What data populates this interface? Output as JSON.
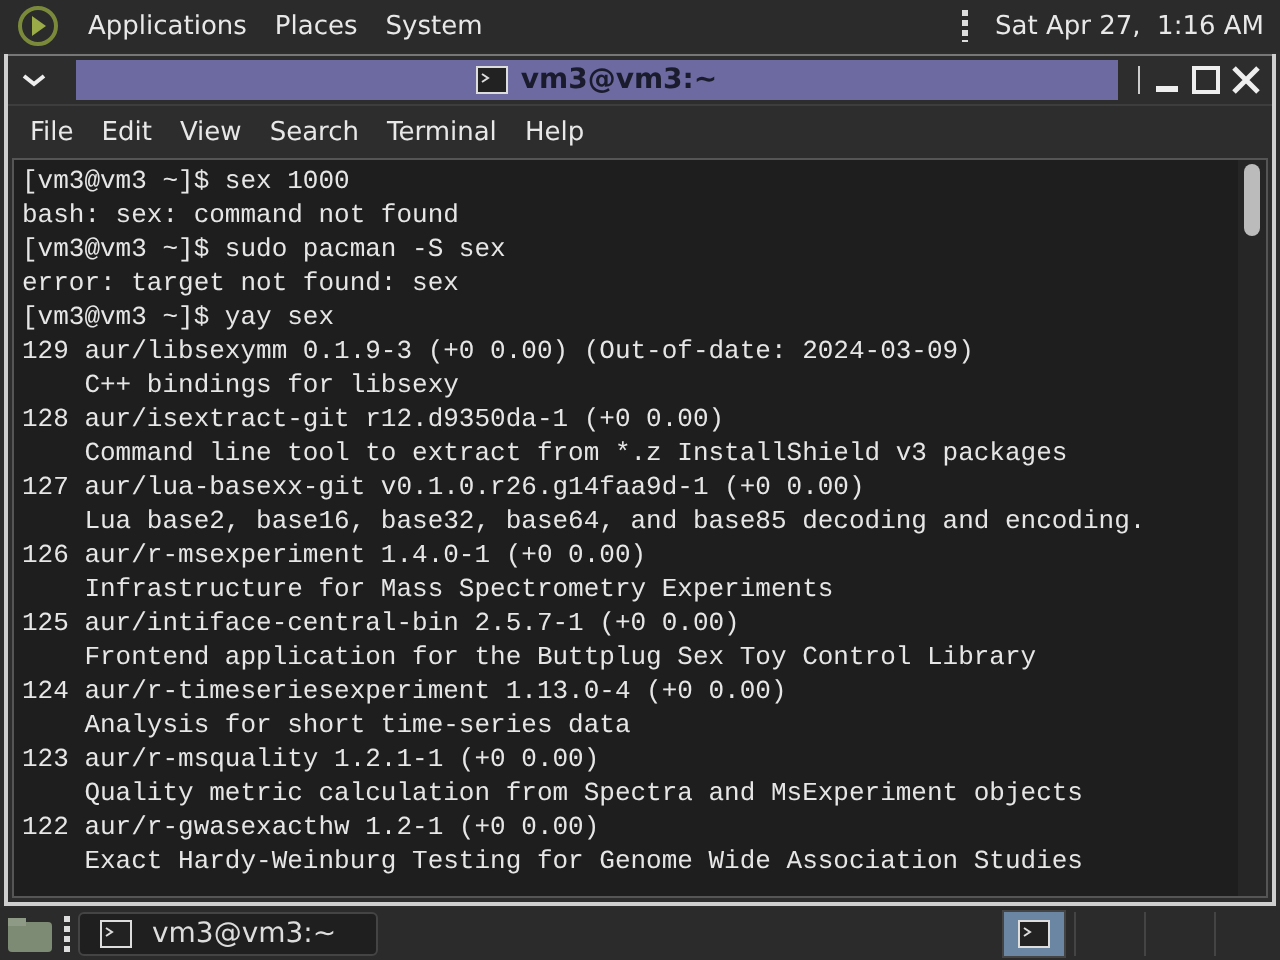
{
  "top_panel": {
    "menus": [
      "Applications",
      "Places",
      "System"
    ],
    "clock": "Sat Apr 27,  1:16 AM"
  },
  "window": {
    "title": "vm3@vm3:~",
    "menu": [
      "File",
      "Edit",
      "View",
      "Search",
      "Terminal",
      "Help"
    ],
    "lines": [
      "[vm3@vm3 ~]$ sex 1000",
      "bash: sex: command not found",
      "[vm3@vm3 ~]$ sudo pacman -S sex",
      "error: target not found: sex",
      "[vm3@vm3 ~]$ yay sex",
      "129 aur/libsexymm 0.1.9-3 (+0 0.00) (Out-of-date: 2024-03-09)",
      "    C++ bindings for libsexy",
      "128 aur/isextract-git r12.d9350da-1 (+0 0.00)",
      "    Command line tool to extract from *.z InstallShield v3 packages",
      "127 aur/lua-basexx-git v0.1.0.r26.g14faa9d-1 (+0 0.00)",
      "    Lua base2, base16, base32, base64, and base85 decoding and encoding.",
      "126 aur/r-msexperiment 1.4.0-1 (+0 0.00)",
      "    Infrastructure for Mass Spectrometry Experiments",
      "125 aur/intiface-central-bin 2.5.7-1 (+0 0.00)",
      "    Frontend application for the Buttplug Sex Toy Control Library",
      "124 aur/r-timeseriesexperiment 1.13.0-4 (+0 0.00)",
      "    Analysis for short time-series data",
      "123 aur/r-msquality 1.2.1-1 (+0 0.00)",
      "    Quality metric calculation from Spectra and MsExperiment objects",
      "122 aur/r-gwasexacthw 1.2-1 (+0 0.00)",
      "    Exact Hardy-Weinburg Testing for Genome Wide Association Studies"
    ]
  },
  "taskbar": {
    "tasks": [
      {
        "label": "vm3@vm3:~",
        "selected": false
      }
    ],
    "workspaces": [
      {
        "selected": true
      }
    ]
  }
}
